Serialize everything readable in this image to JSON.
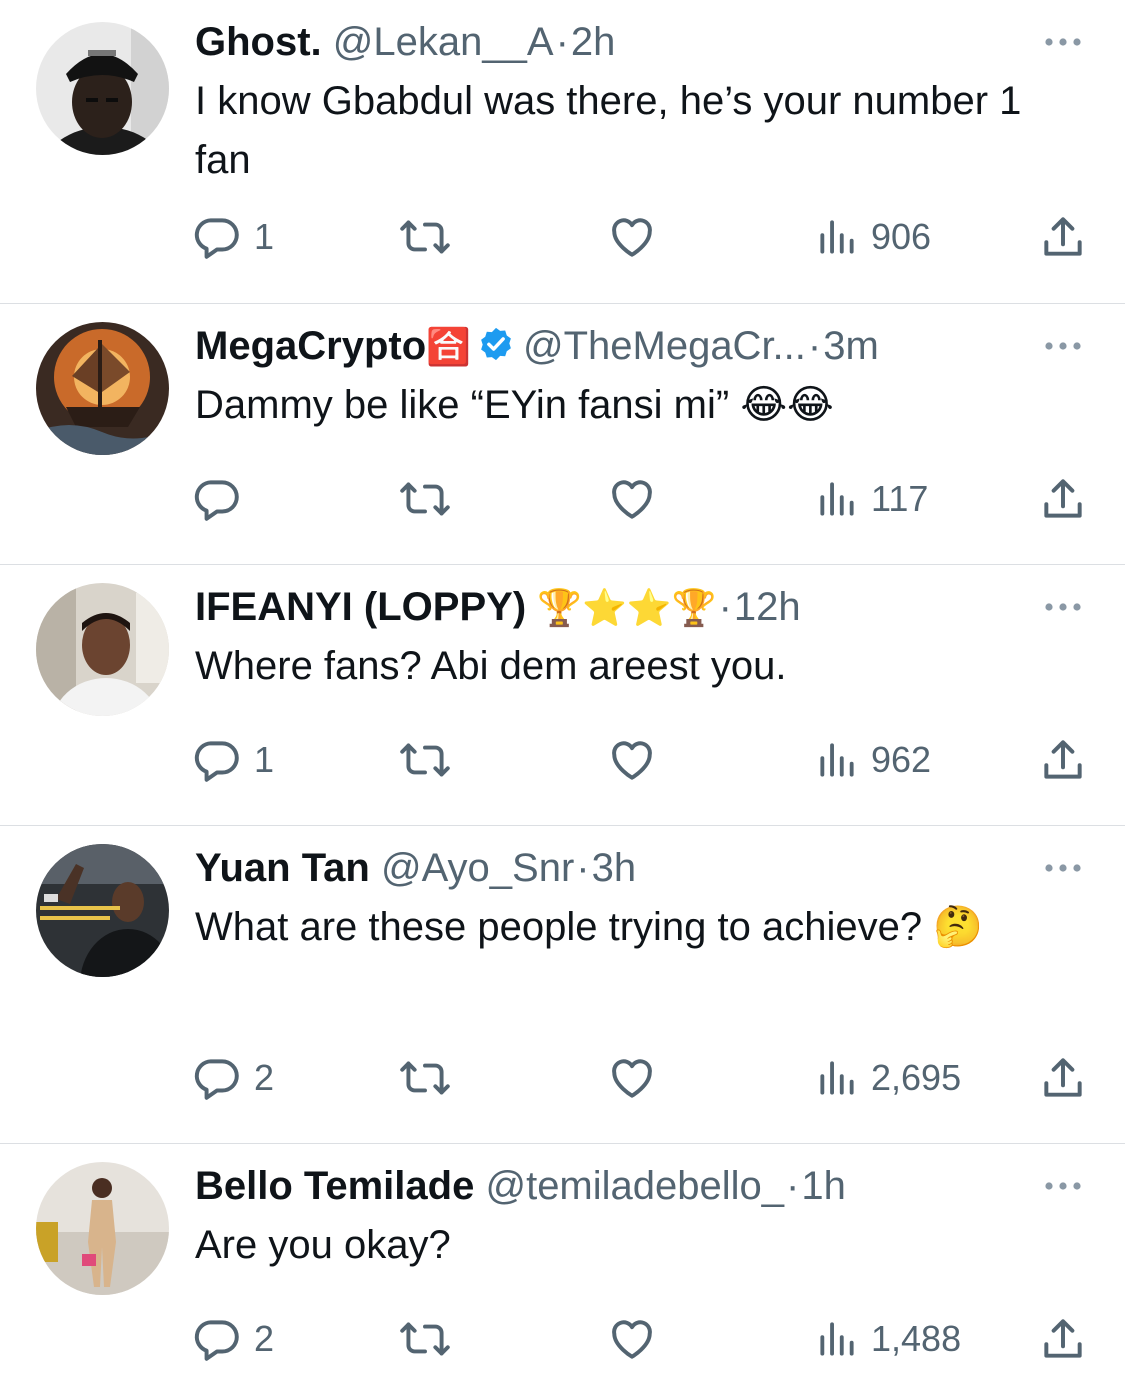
{
  "tweets": [
    {
      "name": "Ghost.",
      "handle": "@Lekan__A",
      "sep": "·",
      "time": "2h",
      "text": "I know Gbabdul was there, he’s your number 1 fan",
      "replies": "1",
      "views": "906",
      "avatar_icon": "profile-photo-man-black-cap"
    },
    {
      "name": "MegaCrypto",
      "name_emoji": "🈴",
      "verified": true,
      "handle": "@TheMegaCr...",
      "sep": "·",
      "time": "3m",
      "text": "Dammy be like “EYin fansi mi” 😂😂",
      "replies": "",
      "views": "117",
      "avatar_icon": "profile-photo-bitcoin-ship"
    },
    {
      "name": "IFEANYI (LOPPY)",
      "name_emoji": "🏆⭐⭐🏆",
      "handle": "",
      "sep": "·",
      "time": "12h",
      "text": "Where fans? Abi dem areest you.",
      "replies": "1",
      "views": "962",
      "avatar_icon": "profile-photo-man-in-car"
    },
    {
      "name": "Yuan Tan",
      "handle": "@Ayo_Snr",
      "sep": "·",
      "time": "3h",
      "text": "What are these people trying to achieve? 🤔",
      "replies": "2",
      "views": "2,695",
      "avatar_icon": "profile-photo-campaign-poster"
    },
    {
      "name": "Bello Temilade",
      "handle": "@temiladebello_",
      "sep": "·",
      "time": "1h",
      "text": "Are you okay?",
      "replies": "2",
      "views": "1,488",
      "avatar_icon": "profile-photo-woman-full-body"
    }
  ],
  "colors": {
    "text": "#0f1419",
    "muted": "#536471",
    "verified": "#1d9bf0",
    "divider": "#dcdfe3"
  }
}
